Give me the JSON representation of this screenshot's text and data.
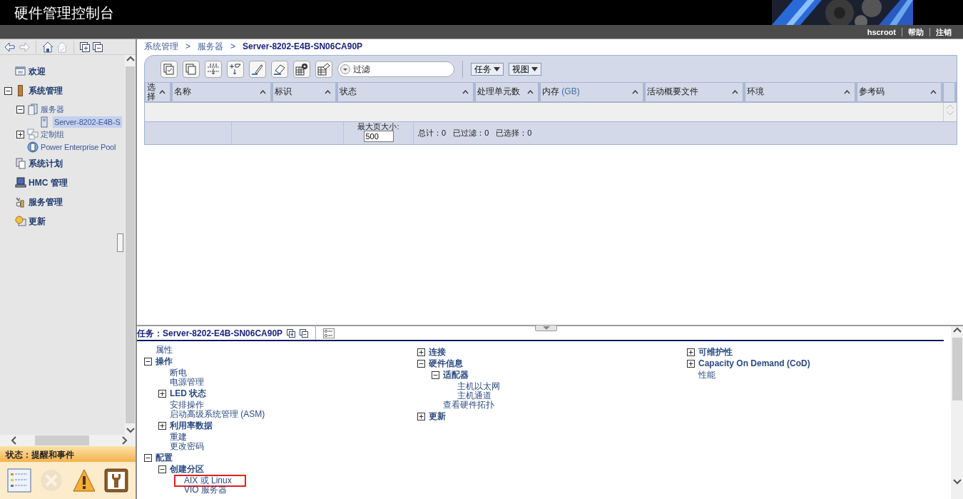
{
  "header": {
    "title": "硬件管理控制台",
    "user_links": [
      "hscroot",
      "帮助",
      "注销"
    ]
  },
  "sidebar": {
    "tree": [
      {
        "label": "欢迎"
      },
      {
        "label": "系统管理",
        "expanded": true,
        "children": [
          {
            "label": "服务器",
            "expanded": true,
            "children": [
              {
                "label": "Server-8202-E4B-S",
                "selected": true
              }
            ]
          },
          {
            "label": "定制组",
            "expanded": false
          },
          {
            "label": "Power Enterprise Pool"
          }
        ]
      },
      {
        "label": "系统计划"
      },
      {
        "label": "HMC 管理"
      },
      {
        "label": "服务管理"
      },
      {
        "label": "更新"
      }
    ]
  },
  "status": {
    "title": "状态：提醒和事件",
    "icons": [
      {
        "disabled": false
      },
      {
        "disabled": true
      },
      {
        "disabled": false
      },
      {
        "disabled": false
      }
    ]
  },
  "breadcrumb": {
    "separator": ">",
    "items": [
      "系统管理",
      "服务器",
      "Server-8202-E4B-SN06CA90P"
    ]
  },
  "table": {
    "filter": {
      "placeholder": "过滤"
    },
    "menus": [
      "任务",
      "视图"
    ],
    "columns": [
      {
        "label": "选择"
      },
      {
        "label": "名称"
      },
      {
        "label": "标识"
      },
      {
        "label": "状态"
      },
      {
        "label": "处理单元数"
      },
      {
        "label": "内存",
        "unit": "(GB)"
      },
      {
        "label": "活动概要文件"
      },
      {
        "label": "环境"
      },
      {
        "label": "参考码"
      }
    ],
    "page_size_label": "最大页大小:",
    "page_size": "500",
    "summary": [
      "总计：0",
      "已过滤：0",
      "已选择：0"
    ]
  },
  "tasks": {
    "title": "任务：Server-8202-E4B-SN06CA90P",
    "columns": [
      [
        {
          "kind": "link",
          "label": "属性"
        },
        {
          "kind": "group",
          "label": "操作",
          "expanded": true,
          "children": [
            {
              "kind": "link",
              "label": "断电"
            },
            {
              "kind": "link",
              "label": "电源管理"
            },
            {
              "kind": "group",
              "label": "LED 状态",
              "expanded": false
            },
            {
              "kind": "link",
              "label": "安排操作"
            },
            {
              "kind": "link",
              "label": "启动高级系统管理 (ASM)"
            },
            {
              "kind": "group",
              "label": "利用率数据",
              "expanded": false
            },
            {
              "kind": "link",
              "label": "重建"
            },
            {
              "kind": "link",
              "label": "更改密码"
            }
          ]
        },
        {
          "kind": "group",
          "label": "配置",
          "expanded": true,
          "children": [
            {
              "kind": "group",
              "label": "创建分区",
              "expanded": true,
              "children": [
                {
                  "kind": "link",
                  "label": "AIX 或 Linux",
                  "highlighted": true
                },
                {
                  "kind": "link",
                  "label": "VIO 服务器",
                  "highlighted": false
                }
              ]
            }
          ]
        }
      ],
      [
        {
          "kind": "group",
          "label": "连接",
          "expanded": false
        },
        {
          "kind": "group",
          "label": "硬件信息",
          "expanded": true,
          "children": [
            {
              "kind": "group",
              "label": "适配器",
              "expanded": true,
              "children": [
                {
                  "kind": "link",
                  "label": "主机以太网"
                },
                {
                  "kind": "link",
                  "label": "主机通道"
                }
              ]
            },
            {
              "kind": "link",
              "label": "查看硬件拓扑"
            }
          ]
        },
        {
          "kind": "group",
          "label": "更新",
          "expanded": false
        }
      ],
      [
        {
          "kind": "group",
          "label": "可维护性",
          "expanded": false
        },
        {
          "kind": "group",
          "label": "Capacity On Demand (CoD)",
          "expanded": false
        },
        {
          "kind": "link",
          "label": "性能"
        }
      ]
    ]
  }
}
